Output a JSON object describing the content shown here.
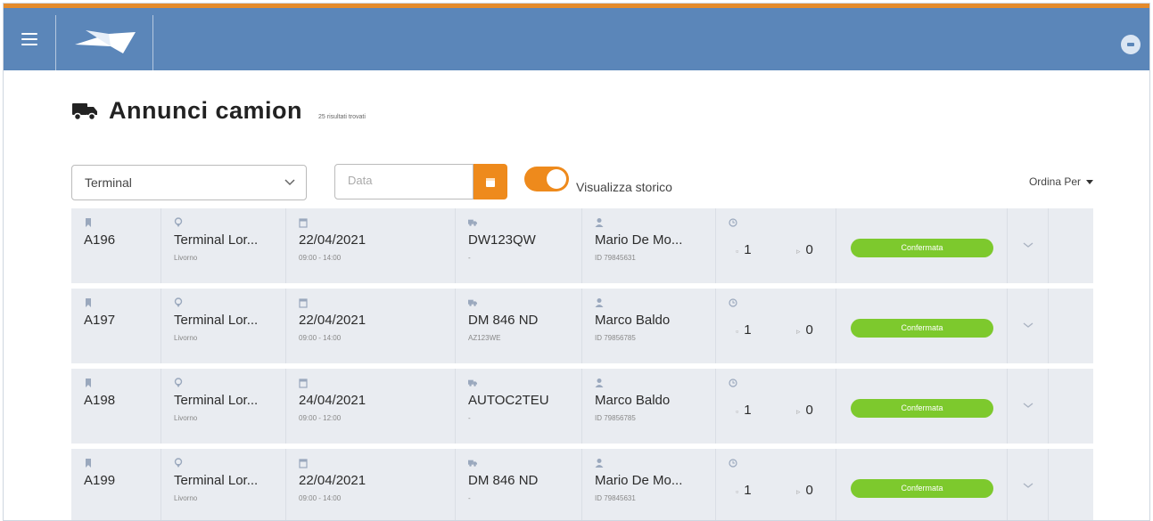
{
  "header": {
    "menu_icon": "hamburger-icon",
    "logo": "paper-plane-logo",
    "user_icon": "user-avatar-icon"
  },
  "page": {
    "title": "Annunci camion",
    "subtitle": "25 risultati trovati"
  },
  "filters": {
    "terminal_value": "Terminal",
    "date_placeholder": "Data",
    "toggle_label": "Visualizza storico",
    "sort_label": "Ordina Per"
  },
  "rows": [
    {
      "id": "A196",
      "terminal": "Terminal Lor...",
      "city": "Livorno",
      "date": "22/04/2021",
      "time": "09:00 - 14:00",
      "plate": "DW123QW",
      "plate_sub": "-",
      "driver": "Mario De Mo...",
      "driver_id": "ID 79845631",
      "count_a": "1",
      "count_b": "0",
      "status": "Confermata"
    },
    {
      "id": "A197",
      "terminal": "Terminal Lor...",
      "city": "Livorno",
      "date": "22/04/2021",
      "time": "09:00 - 14:00",
      "plate": "DM 846 ND",
      "plate_sub": "AZ123WE",
      "driver": "Marco Baldo",
      "driver_id": "ID 79856785",
      "count_a": "1",
      "count_b": "0",
      "status": "Confermata"
    },
    {
      "id": "A198",
      "terminal": "Terminal Lor...",
      "city": "Livorno",
      "date": "24/04/2021",
      "time": "09:00 - 12:00",
      "plate": "AUTOC2TEU",
      "plate_sub": "-",
      "driver": "Marco Baldo",
      "driver_id": "ID 79856785",
      "count_a": "1",
      "count_b": "0",
      "status": "Confermata"
    },
    {
      "id": "A199",
      "terminal": "Terminal Lor...",
      "city": "Livorno",
      "date": "22/04/2021",
      "time": "09:00 - 14:00",
      "plate": "DM 846 ND",
      "plate_sub": "-",
      "driver": "Mario De Mo...",
      "driver_id": "ID 79845631",
      "count_a": "1",
      "count_b": "0",
      "status": "Confermata"
    }
  ],
  "colors": {
    "appbar": "#5b86b9",
    "accent": "#ee8a1c",
    "status_green": "#7dc92d"
  }
}
